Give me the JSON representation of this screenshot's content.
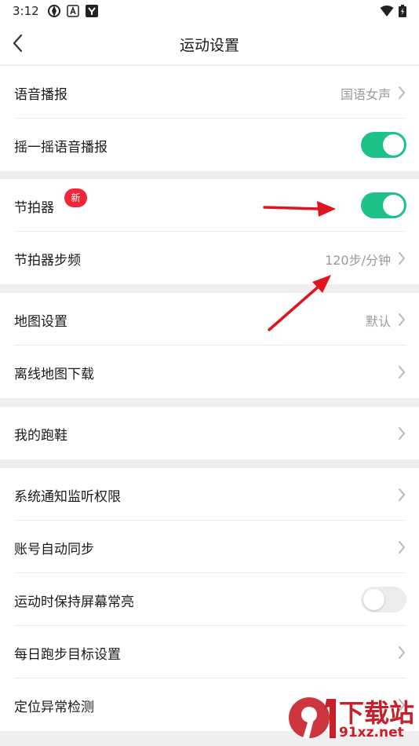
{
  "status_bar": {
    "time": "3:12",
    "left_icons": [
      "sync-icon",
      "a-icon",
      "app-icon"
    ],
    "right_icons": [
      "wifi-icon",
      "battery-icon"
    ]
  },
  "nav": {
    "title": "运动设置",
    "back_icon": "chevron-left-icon"
  },
  "groups": [
    {
      "rows": [
        {
          "label": "语音播报",
          "value": "国语女声",
          "control": "chevron"
        },
        {
          "label": "摇一摇语音播报",
          "control": "toggle",
          "on": true
        }
      ]
    },
    {
      "rows": [
        {
          "label": "节拍器",
          "badge": "新",
          "control": "toggle",
          "on": true
        },
        {
          "label": "节拍器步频",
          "value": "120步/分钟",
          "control": "chevron"
        }
      ]
    },
    {
      "rows": [
        {
          "label": "地图设置",
          "value": "默认",
          "control": "chevron"
        },
        {
          "label": "离线地图下载",
          "control": "chevron"
        }
      ]
    },
    {
      "rows": [
        {
          "label": "我的跑鞋",
          "control": "chevron"
        }
      ]
    },
    {
      "rows": [
        {
          "label": "系统通知监听权限",
          "control": "chevron"
        },
        {
          "label": "账号自动同步",
          "control": "chevron"
        },
        {
          "label": "运动时保持屏幕常亮",
          "control": "toggle",
          "on": false
        },
        {
          "label": "每日跑步目标设置",
          "control": "chevron"
        },
        {
          "label": "定位异常检测",
          "control": "chevron"
        }
      ]
    }
  ],
  "colors": {
    "accent_toggle": "#1cc288",
    "badge": "#f0263b",
    "annotation_arrow": "#e0141e"
  },
  "watermark": {
    "line1": "下载站",
    "line2": "91xz.net"
  }
}
